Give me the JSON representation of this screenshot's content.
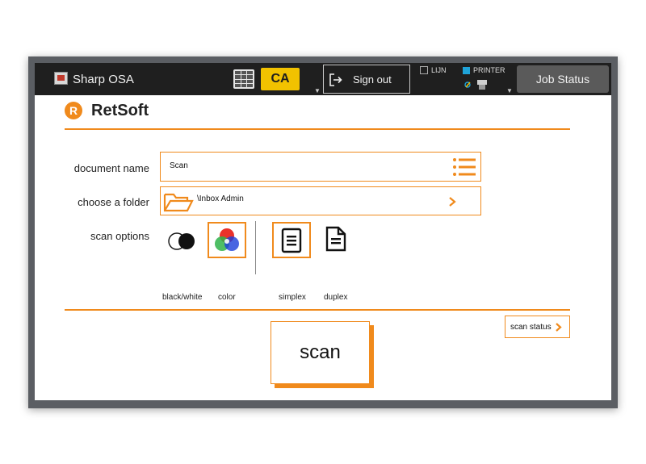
{
  "topbar": {
    "app_title": "Sharp OSA",
    "ca_label": "CA",
    "signout_label": "Sign out",
    "lijn_label": "LIJN",
    "printer_label": "PRINTER",
    "job_status_label": "Job Status"
  },
  "brand": {
    "name": "RetSoft",
    "logo_letter": "R",
    "accent": "#f08a1c"
  },
  "form": {
    "document_name": {
      "label": "document name",
      "value": "Scan"
    },
    "folder": {
      "label": "choose a folder",
      "value": "\\Inbox Admin"
    },
    "scan_options": {
      "label": "scan options",
      "color_modes": [
        {
          "label": "black/white",
          "selected": false
        },
        {
          "label": "color",
          "selected": true
        }
      ],
      "sides": [
        {
          "label": "simplex",
          "selected": true
        },
        {
          "label": "duplex",
          "selected": false
        }
      ]
    }
  },
  "actions": {
    "scan_label": "scan",
    "scan_status_label": "scan status"
  }
}
